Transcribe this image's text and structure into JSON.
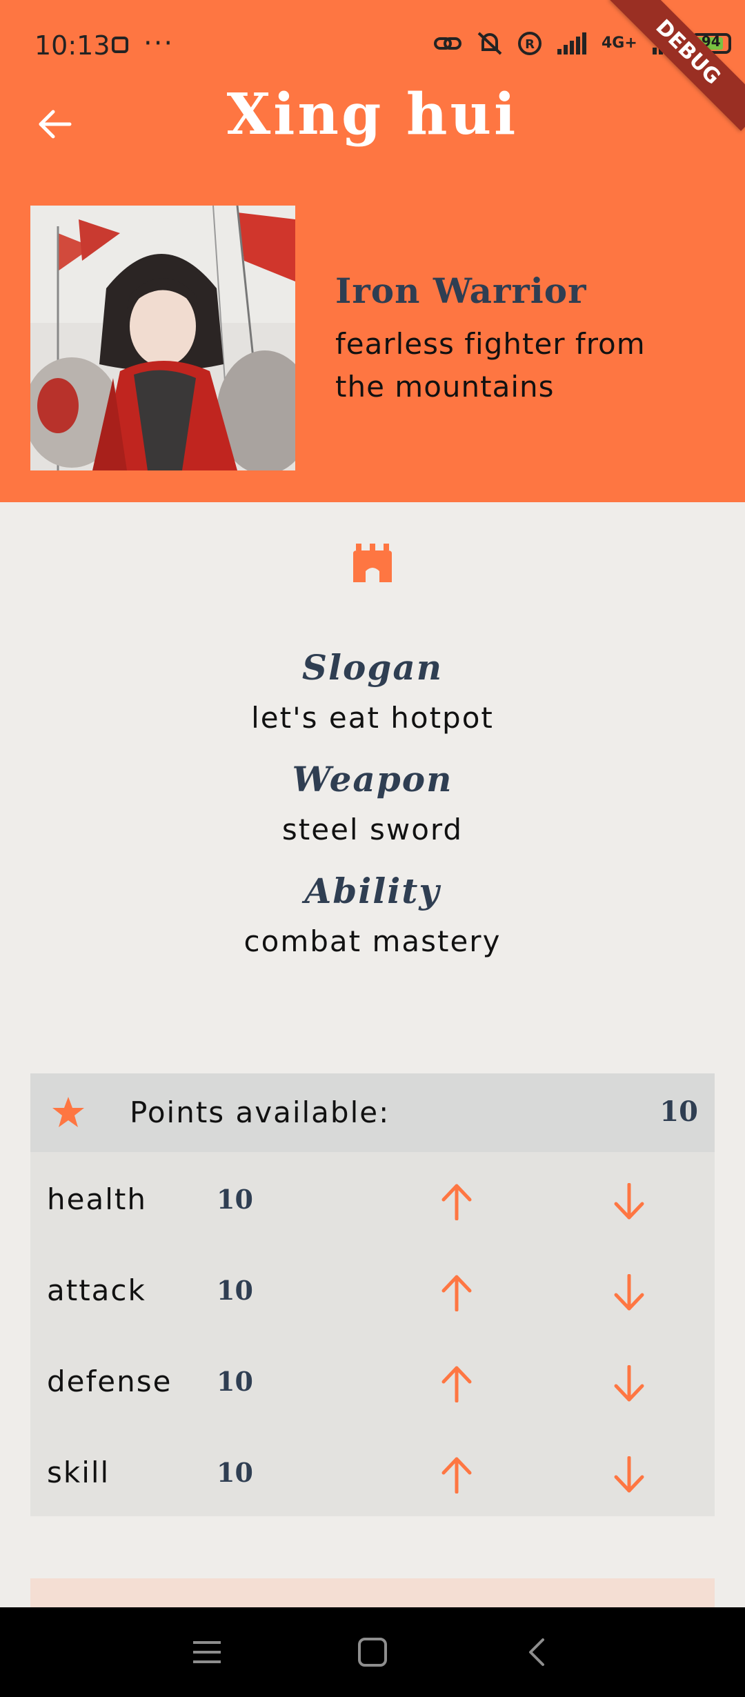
{
  "status_bar": {
    "time": "10:13",
    "more": "···",
    "network": "4G+",
    "battery": "94"
  },
  "debug_banner": "DEBUG",
  "header": {
    "title": "Xing hui",
    "back_icon": "arrow-left-icon"
  },
  "character": {
    "class_title": "Iron Warrior",
    "class_description": "fearless fighter from the mountains"
  },
  "info": {
    "slogan_label": "Slogan",
    "slogan_value": "let's eat hotpot",
    "weapon_label": "Weapon",
    "weapon_value": "steel sword",
    "ability_label": "Ability",
    "ability_value": "combat mastery"
  },
  "stats": {
    "points_label": "Points available:",
    "points_value": "10",
    "rows": [
      {
        "name": "health",
        "value": "10"
      },
      {
        "name": "attack",
        "value": "10"
      },
      {
        "name": "defense",
        "value": "10"
      },
      {
        "name": "skill",
        "value": "10"
      }
    ]
  },
  "colors": {
    "accent": "#fe7642",
    "heading": "#2f3e52",
    "background": "#efedea"
  }
}
